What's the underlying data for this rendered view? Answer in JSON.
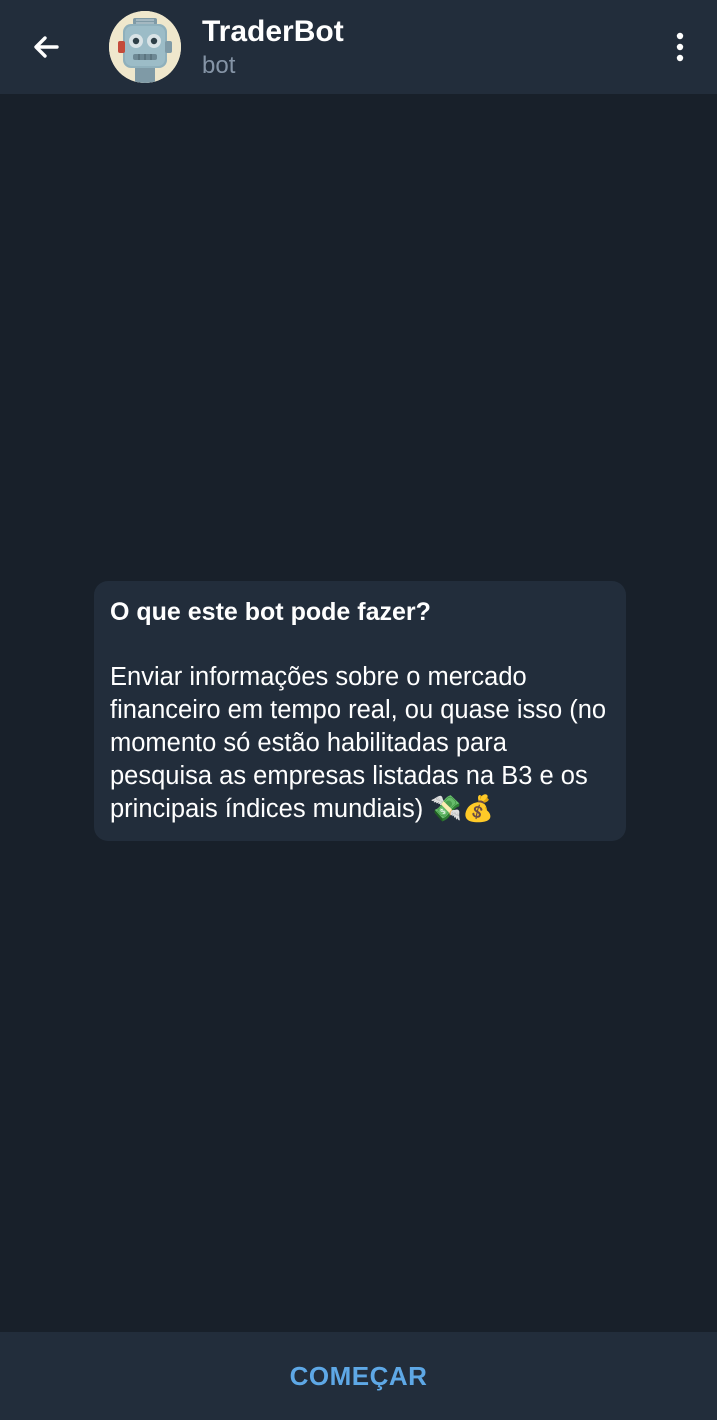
{
  "header": {
    "title": "TraderBot",
    "subtitle": "bot"
  },
  "intro": {
    "heading": "O que este bot pode fazer?",
    "body": "Enviar informações sobre o mercado financeiro em tempo real, ou quase isso (no momento só estão habilitadas para pesquisa as empresas listadas na B3 e os principais índices mundiais) 💸💰"
  },
  "bottom": {
    "start_label": "COMEÇAR"
  },
  "colors": {
    "background": "#18202a",
    "bar": "#222d3b",
    "accent": "#5ea8e6",
    "subtitle": "#8594a6"
  },
  "icons": {
    "back": "arrow-left-icon",
    "menu": "more-vertical-icon",
    "avatar": "robot-avatar"
  }
}
